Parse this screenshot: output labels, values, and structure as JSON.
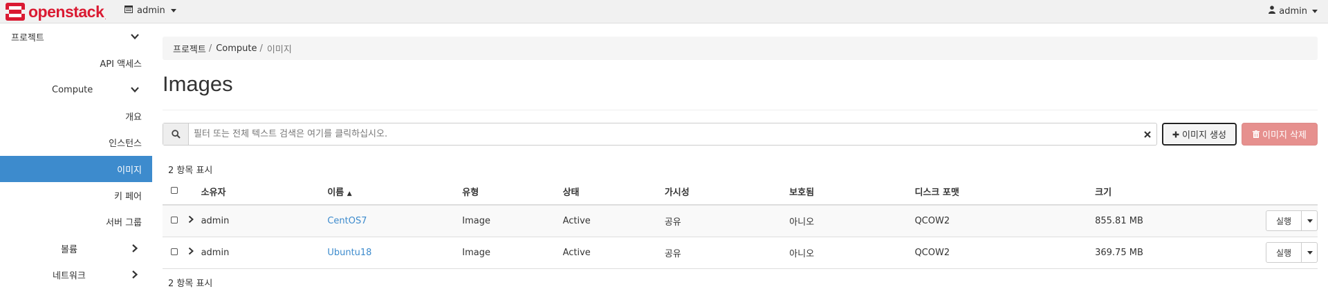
{
  "topbar": {
    "brand": "openstack",
    "brand_tm": ".",
    "project": "admin",
    "user": "admin"
  },
  "sidebar": {
    "items": [
      {
        "label": "프로젝트"
      },
      {
        "label": "API 액세스"
      },
      {
        "label": "Compute"
      },
      {
        "label": "개요"
      },
      {
        "label": "인스턴스"
      },
      {
        "label": "이미지"
      },
      {
        "label": "키 페어"
      },
      {
        "label": "서버 그룹"
      },
      {
        "label": "볼륨"
      },
      {
        "label": "네트워크"
      }
    ]
  },
  "breadcrumb": {
    "items": [
      "프로젝트",
      "Compute",
      "이미지"
    ],
    "separator": "/"
  },
  "page": {
    "title": "Images"
  },
  "filter": {
    "placeholder": "필터 또는 전체 텍스트 검색은 여기를 클릭하십시오."
  },
  "actions": {
    "create_label": "이미지 생성",
    "delete_label": "이미지 삭제"
  },
  "count_text_top": "2 항목 표시",
  "count_text_bottom": "2 항목 표시",
  "table": {
    "headers": {
      "owner": "소유자",
      "name": "이름",
      "type": "유형",
      "status": "상태",
      "visibility": "가시성",
      "protected": "보호됨",
      "disk_format": "디스크 포맷",
      "size": "크기"
    },
    "sort_indicator": "▲",
    "launch_label": "실행",
    "rows": [
      {
        "owner": "admin",
        "name": "CentOS7",
        "type": "Image",
        "status": "Active",
        "visibility": "공유",
        "protected": "아니오",
        "disk_format": "QCOW2",
        "size": "855.81 MB"
      },
      {
        "owner": "admin",
        "name": "Ubuntu18",
        "type": "Image",
        "status": "Active",
        "visibility": "공유",
        "protected": "아니오",
        "disk_format": "QCOW2",
        "size": "369.75 MB"
      }
    ]
  },
  "colors": {
    "brand": "#da1a32",
    "active_nav": "#3d8bcd",
    "link": "#3d8bcd",
    "danger": "#e6908e"
  }
}
